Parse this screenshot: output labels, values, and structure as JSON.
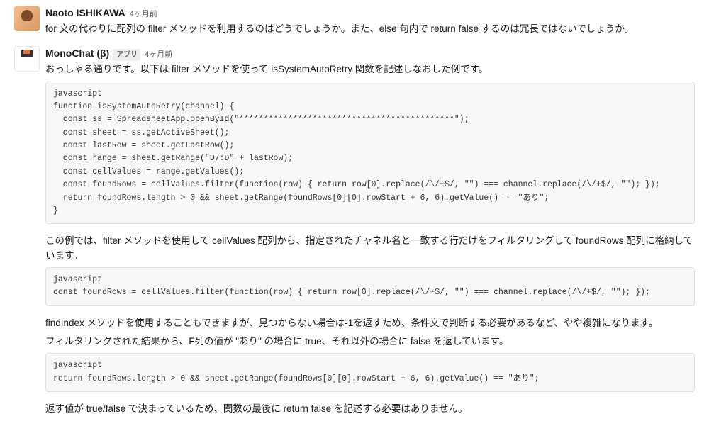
{
  "messages": [
    {
      "author": "Naoto ISHIKAWA",
      "timestamp": "4ヶ月前",
      "text": "for 文の代わりに配列の filter メソッドを利用するのはどうでしょうか。また、else 句内で return false するのは冗長ではないでしょうか。"
    },
    {
      "author": "MonoChat (β)",
      "badge": "アプリ",
      "timestamp": "4ヶ月前",
      "intro": "おっしゃる通りです。以下は filter メソッドを使って isSystemAutoRetry 関数を記述しなおした例です。",
      "code1": "javascript\nfunction isSystemAutoRetry(channel) {\n  const ss = SpreadsheetApp.openById(\"********************************************\");\n  const sheet = ss.getActiveSheet();\n  const lastRow = sheet.getLastRow();\n  const range = sheet.getRange(\"D7:D\" + lastRow);\n  const cellValues = range.getValues();\n  const foundRows = cellValues.filter(function(row) { return row[0].replace(/\\/+$/, \"\") === channel.replace(/\\/+$/, \"\"); });\n  return foundRows.length > 0 && sheet.getRange(foundRows[0][0].rowStart + 6, 6).getValue() == \"あり\";\n}",
      "para1": "この例では、filter メソッドを使用して cellValues 配列から、指定されたチャネル名と一致する行だけをフィルタリングして foundRows 配列に格納しています。",
      "code2": "javascript\nconst foundRows = cellValues.filter(function(row) { return row[0].replace(/\\/+$/, \"\") === channel.replace(/\\/+$/, \"\"); });",
      "para2": "findIndex メソッドを使用することもできますが、見つからない場合は-1を返すため、条件文で判断する必要があるなど、やや複雑になります。",
      "para3": "フィルタリングされた結果から、F列の値が \"あり\" の場合に true、それ以外の場合に false を返しています。",
      "code3": "javascript\nreturn foundRows.length > 0 && sheet.getRange(foundRows[0][0].rowStart + 6, 6).getValue() == \"あり\";",
      "para4": "返す値が true/false で決まっているため、関数の最後に return false を記述する必要はありません。"
    }
  ]
}
